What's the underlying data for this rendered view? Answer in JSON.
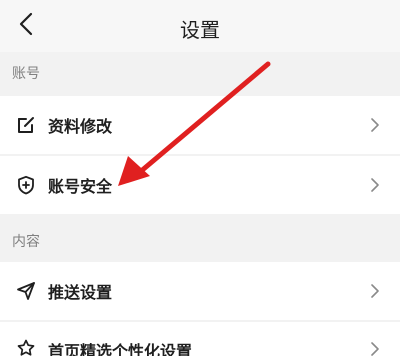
{
  "header": {
    "title": "设置"
  },
  "sections": [
    {
      "label": "账号"
    },
    {
      "label": "内容"
    }
  ],
  "rows": [
    {
      "label": "资料修改",
      "icon": "edit-icon"
    },
    {
      "label": "账号安全",
      "icon": "shield-plus-icon"
    },
    {
      "label": "推送设置",
      "icon": "send-icon"
    },
    {
      "label": "首页精选个性化设置",
      "icon": "star-badge-icon"
    }
  ],
  "colors": {
    "annotation_arrow": "#e02020",
    "background": "#f2f2f2",
    "row_background": "#ffffff"
  }
}
